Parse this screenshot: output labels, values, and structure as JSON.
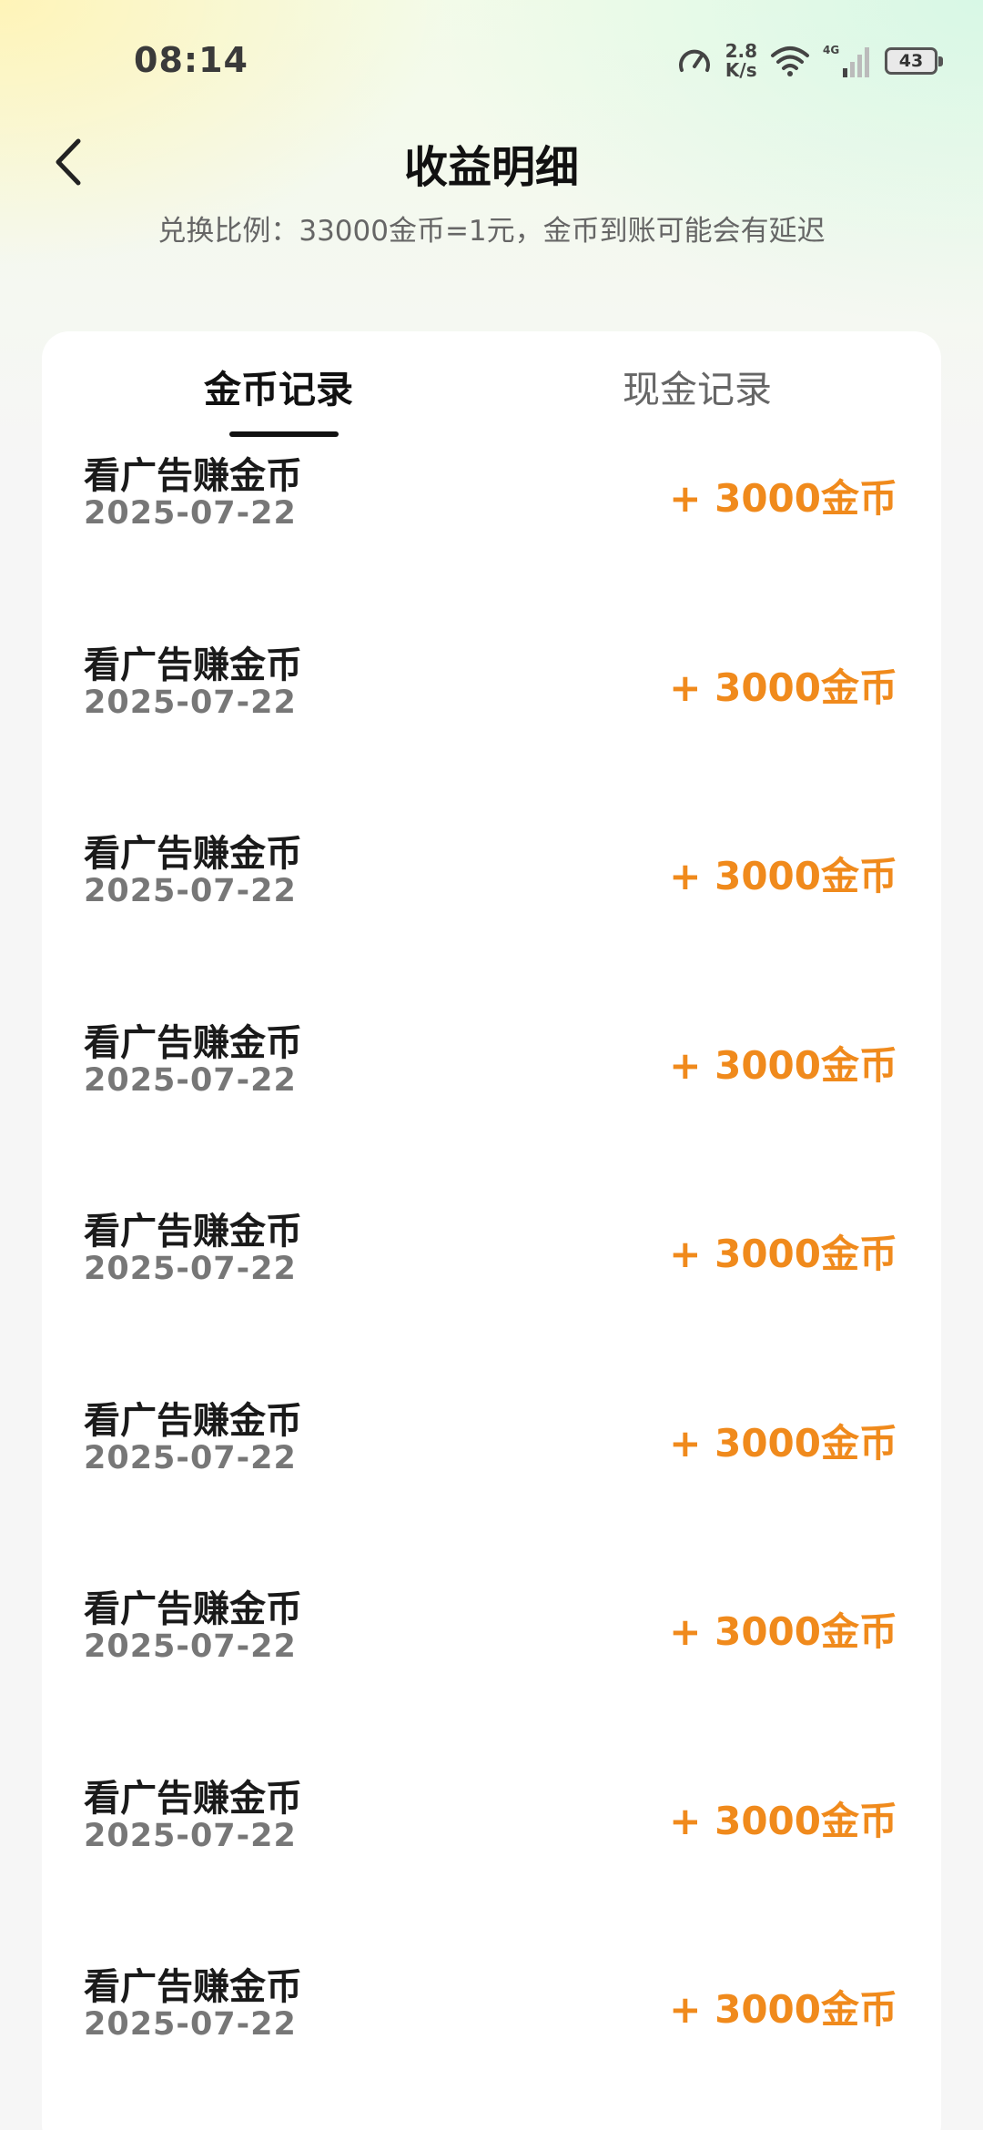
{
  "status_bar": {
    "time": "08:14",
    "net_speed_value": "2.8",
    "net_speed_unit": "K/s",
    "network_type": "4G",
    "battery": "43"
  },
  "header": {
    "title": "收益明细",
    "subtitle": "兑换比例：33000金币=1元，金币到账可能会有延迟"
  },
  "tabs": [
    {
      "label": "金币记录",
      "active": true
    },
    {
      "label": "现金记录",
      "active": false
    }
  ],
  "records": [
    {
      "title": "看广告赚金币",
      "date": "2025-07-22",
      "amount": "+ 3000金币"
    },
    {
      "title": "看广告赚金币",
      "date": "2025-07-22",
      "amount": "+ 3000金币"
    },
    {
      "title": "看广告赚金币",
      "date": "2025-07-22",
      "amount": "+ 3000金币"
    },
    {
      "title": "看广告赚金币",
      "date": "2025-07-22",
      "amount": "+ 3000金币"
    },
    {
      "title": "看广告赚金币",
      "date": "2025-07-22",
      "amount": "+ 3000金币"
    },
    {
      "title": "看广告赚金币",
      "date": "2025-07-22",
      "amount": "+ 3000金币"
    },
    {
      "title": "看广告赚金币",
      "date": "2025-07-22",
      "amount": "+ 3000金币"
    },
    {
      "title": "看广告赚金币",
      "date": "2025-07-22",
      "amount": "+ 3000金币"
    },
    {
      "title": "看广告赚金币",
      "date": "2025-07-22",
      "amount": "+ 3000金币"
    }
  ],
  "colors": {
    "amount": "#f08a1c",
    "title_text": "#111111",
    "secondary_text": "#777777"
  }
}
